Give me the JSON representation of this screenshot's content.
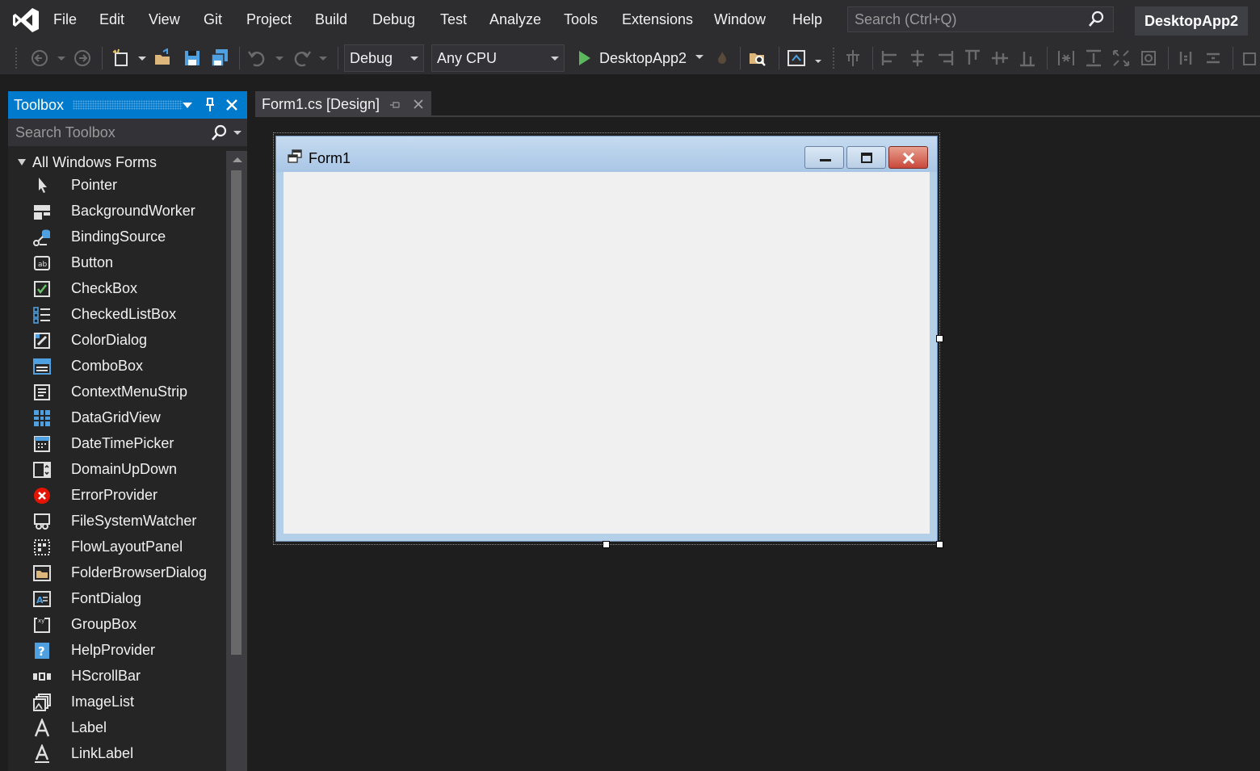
{
  "menubar": {
    "items": [
      "File",
      "Edit",
      "View",
      "Git",
      "Project",
      "Build",
      "Debug",
      "Test",
      "Analyze",
      "Tools",
      "Extensions",
      "Window",
      "Help"
    ],
    "search_placeholder": "Search (Ctrl+Q)",
    "project_name": "DesktopApp2"
  },
  "toolbar": {
    "configuration": "Debug",
    "platform": "Any CPU",
    "run_target": "DesktopApp2"
  },
  "toolbox": {
    "title": "Toolbox",
    "search_placeholder": "Search Toolbox",
    "group": "All Windows Forms",
    "items": [
      {
        "label": "Pointer",
        "icon": "pointer-icon"
      },
      {
        "label": "BackgroundWorker",
        "icon": "background-worker-icon"
      },
      {
        "label": "BindingSource",
        "icon": "binding-source-icon"
      },
      {
        "label": "Button",
        "icon": "button-icon"
      },
      {
        "label": "CheckBox",
        "icon": "checkbox-icon"
      },
      {
        "label": "CheckedListBox",
        "icon": "checked-list-box-icon"
      },
      {
        "label": "ColorDialog",
        "icon": "color-dialog-icon"
      },
      {
        "label": "ComboBox",
        "icon": "combo-box-icon"
      },
      {
        "label": "ContextMenuStrip",
        "icon": "context-menu-strip-icon"
      },
      {
        "label": "DataGridView",
        "icon": "data-grid-view-icon"
      },
      {
        "label": "DateTimePicker",
        "icon": "date-time-picker-icon"
      },
      {
        "label": "DomainUpDown",
        "icon": "domain-up-down-icon"
      },
      {
        "label": "ErrorProvider",
        "icon": "error-provider-icon"
      },
      {
        "label": "FileSystemWatcher",
        "icon": "file-system-watcher-icon"
      },
      {
        "label": "FlowLayoutPanel",
        "icon": "flow-layout-panel-icon"
      },
      {
        "label": "FolderBrowserDialog",
        "icon": "folder-browser-dialog-icon"
      },
      {
        "label": "FontDialog",
        "icon": "font-dialog-icon"
      },
      {
        "label": "GroupBox",
        "icon": "group-box-icon"
      },
      {
        "label": "HelpProvider",
        "icon": "help-provider-icon"
      },
      {
        "label": "HScrollBar",
        "icon": "hscrollbar-icon"
      },
      {
        "label": "ImageList",
        "icon": "image-list-icon"
      },
      {
        "label": "Label",
        "icon": "label-icon"
      },
      {
        "label": "LinkLabel",
        "icon": "link-label-icon"
      }
    ]
  },
  "document": {
    "tab_label": "Form1.cs [Design]",
    "form_title": "Form1"
  },
  "colors": {
    "accent": "#007acc",
    "background": "#1e1e1e",
    "chrome": "#2d2d30",
    "run_green": "#5cb85c",
    "form_client": "#f0f0f0",
    "close_red": "#c8483a"
  }
}
